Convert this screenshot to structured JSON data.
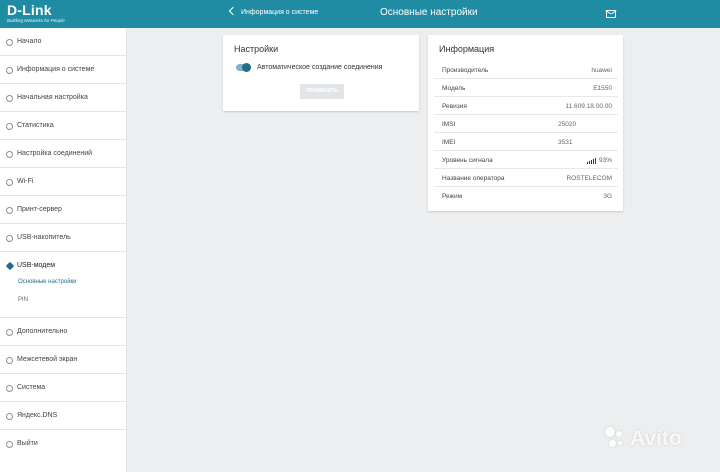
{
  "header": {
    "logo_main": "D-Link",
    "logo_sub": "Building Networks for People",
    "back_label": "Информация о системе",
    "page_title": "Основные настройки",
    "accent_color": "#1f8ca4"
  },
  "sidebar": {
    "items": [
      {
        "label": "Начало",
        "icon": "home-icon"
      },
      {
        "label": "Информация о системе",
        "icon": "info-icon"
      },
      {
        "label": "Начальная настройка",
        "icon": "wand-icon"
      },
      {
        "label": "Статистика",
        "icon": "stats-icon"
      },
      {
        "label": "Настройка соединений",
        "icon": "connections-icon"
      },
      {
        "label": "Wi-Fi",
        "icon": "wifi-icon"
      },
      {
        "label": "Принт-сервер",
        "icon": "printer-icon"
      },
      {
        "label": "USB-накопитель",
        "icon": "usb-storage-icon"
      },
      {
        "label": "USB-модем",
        "icon": "usb-modem-icon"
      },
      {
        "label": "Дополнительно",
        "icon": "advanced-icon"
      },
      {
        "label": "Межсетевой экран",
        "icon": "firewall-icon"
      },
      {
        "label": "Система",
        "icon": "gear-icon"
      },
      {
        "label": "Яндекс.DNS",
        "icon": "dns-icon"
      },
      {
        "label": "Выйти",
        "icon": "logout-icon"
      }
    ],
    "sub_items": [
      {
        "label": "Основные настройки"
      },
      {
        "label": "PIN"
      }
    ]
  },
  "settings": {
    "title": "Настройки",
    "toggle_label": "Автоматическое создание соединения",
    "toggle_on": true,
    "apply_label": "ПРИМЕНИТЬ"
  },
  "info": {
    "title": "Информация",
    "rows": [
      {
        "key": "Производитель",
        "value": "huawei"
      },
      {
        "key": "Модель",
        "value": "E1550"
      },
      {
        "key": "Ревизия",
        "value": "11.609.18.00.00"
      },
      {
        "key": "IMSI",
        "value": "25020"
      },
      {
        "key": "IMEI",
        "value": "3531"
      },
      {
        "key": "Уровень сигнала",
        "value": "93%"
      },
      {
        "key": "Название оператора",
        "value": "ROSTELECOM"
      },
      {
        "key": "Режим",
        "value": "3G"
      }
    ]
  },
  "watermark": {
    "text": "Avito"
  }
}
